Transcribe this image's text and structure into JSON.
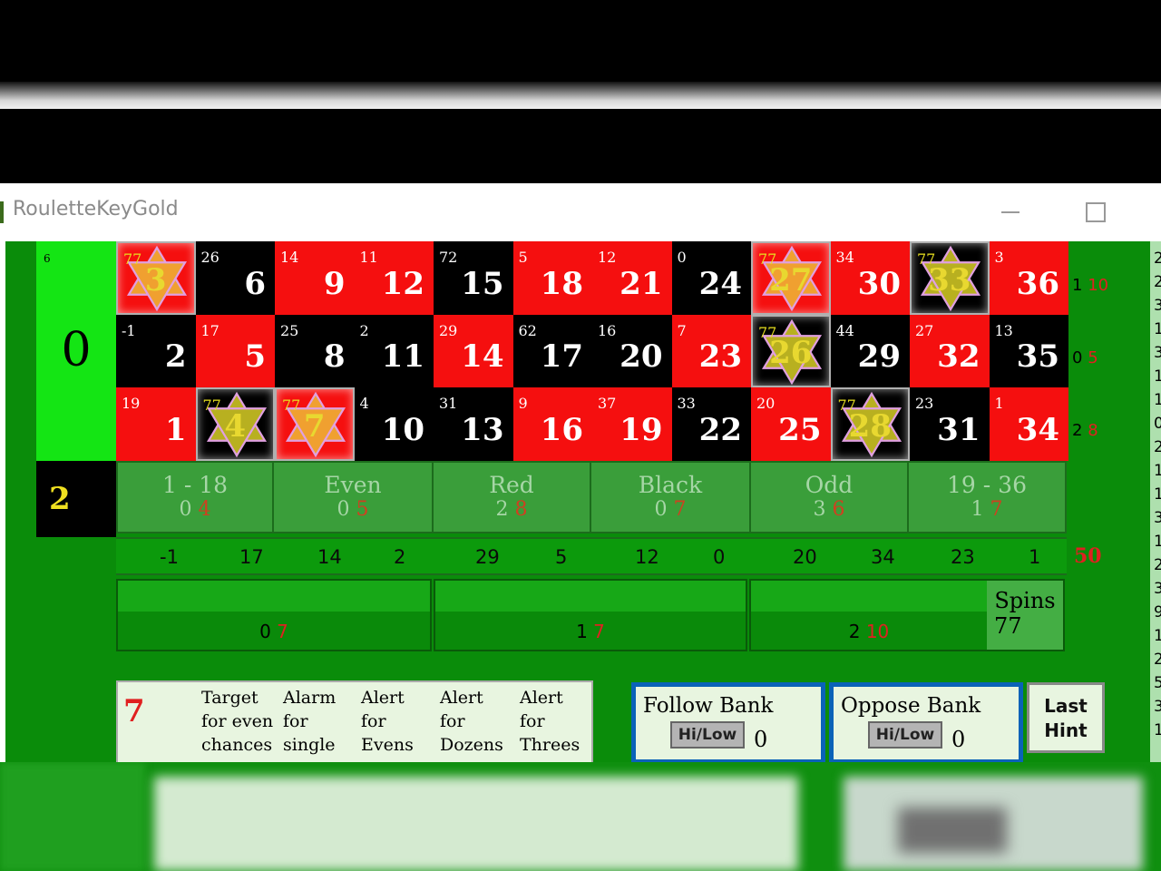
{
  "window": {
    "title": "RouletteKeyGold"
  },
  "zero": {
    "count": "6",
    "number": "0"
  },
  "cells": [
    {
      "n": "3",
      "c": "77",
      "color": "red",
      "hi": true
    },
    {
      "n": "6",
      "c": "26",
      "color": "black",
      "hi": false
    },
    {
      "n": "9",
      "c": "14",
      "color": "red",
      "hi": false
    },
    {
      "n": "12",
      "c": "11",
      "color": "red",
      "hi": false
    },
    {
      "n": "15",
      "c": "72",
      "color": "black",
      "hi": false
    },
    {
      "n": "18",
      "c": "5",
      "color": "red",
      "hi": false
    },
    {
      "n": "21",
      "c": "12",
      "color": "red",
      "hi": false
    },
    {
      "n": "24",
      "c": "0",
      "color": "black",
      "hi": false
    },
    {
      "n": "27",
      "c": "77",
      "color": "red",
      "hi": true
    },
    {
      "n": "30",
      "c": "34",
      "color": "red",
      "hi": false
    },
    {
      "n": "33",
      "c": "77",
      "color": "black",
      "hi": true
    },
    {
      "n": "36",
      "c": "3",
      "color": "red",
      "hi": false
    },
    {
      "n": "2",
      "c": "-1",
      "color": "black",
      "hi": false
    },
    {
      "n": "5",
      "c": "17",
      "color": "red",
      "hi": false
    },
    {
      "n": "8",
      "c": "25",
      "color": "black",
      "hi": false
    },
    {
      "n": "11",
      "c": "2",
      "color": "black",
      "hi": false
    },
    {
      "n": "14",
      "c": "29",
      "color": "red",
      "hi": false
    },
    {
      "n": "17",
      "c": "62",
      "color": "black",
      "hi": false
    },
    {
      "n": "20",
      "c": "16",
      "color": "black",
      "hi": false
    },
    {
      "n": "23",
      "c": "7",
      "color": "red",
      "hi": false
    },
    {
      "n": "26",
      "c": "77",
      "color": "black",
      "hi": true
    },
    {
      "n": "29",
      "c": "44",
      "color": "black",
      "hi": false
    },
    {
      "n": "32",
      "c": "27",
      "color": "red",
      "hi": false
    },
    {
      "n": "35",
      "c": "13",
      "color": "black",
      "hi": false
    },
    {
      "n": "1",
      "c": "19",
      "color": "red",
      "hi": false
    },
    {
      "n": "4",
      "c": "77",
      "color": "black",
      "hi": true
    },
    {
      "n": "7",
      "c": "77",
      "color": "red",
      "hi": true
    },
    {
      "n": "10",
      "c": "4",
      "color": "black",
      "hi": false
    },
    {
      "n": "13",
      "c": "31",
      "color": "black",
      "hi": false
    },
    {
      "n": "16",
      "c": "9",
      "color": "red",
      "hi": false
    },
    {
      "n": "19",
      "c": "37",
      "color": "red",
      "hi": false
    },
    {
      "n": "22",
      "c": "33",
      "color": "black",
      "hi": false
    },
    {
      "n": "25",
      "c": "20",
      "color": "red",
      "hi": false
    },
    {
      "n": "28",
      "c": "77",
      "color": "black",
      "hi": true
    },
    {
      "n": "31",
      "c": "23",
      "color": "black",
      "hi": false
    },
    {
      "n": "34",
      "c": "1",
      "color": "red",
      "hi": false
    }
  ],
  "row_side": [
    {
      "a": "1",
      "b": "10"
    },
    {
      "a": "0",
      "b": "5"
    },
    {
      "a": "2",
      "b": "8"
    }
  ],
  "dozen_box": "2",
  "even_bets": [
    {
      "label": "1 - 18",
      "a": "0",
      "b": "4"
    },
    {
      "label": "Even",
      "a": "0",
      "b": "5"
    },
    {
      "label": "Red",
      "a": "2",
      "b": "8"
    },
    {
      "label": "Black",
      "a": "0",
      "b": "7"
    },
    {
      "label": "Odd",
      "a": "3",
      "b": "6"
    },
    {
      "label": "19 - 36",
      "a": "1",
      "b": "7"
    }
  ],
  "history": [
    "-1",
    "17",
    "14",
    "2",
    "29",
    "5",
    "12",
    "0",
    "20",
    "34",
    "23",
    "1"
  ],
  "history_total": "50",
  "columns": [
    {
      "a": "0",
      "b": "7"
    },
    {
      "a": "1",
      "b": "7"
    },
    {
      "a": "2",
      "b": "10"
    }
  ],
  "spins": {
    "label": "Spins",
    "value": "77"
  },
  "info": {
    "big": "7",
    "cols": [
      [
        "Target",
        "for even",
        "chances"
      ],
      [
        "Alarm",
        "for",
        "single"
      ],
      [
        "Alert",
        "for",
        "Evens"
      ],
      [
        "Alert",
        "for",
        "Dozens"
      ],
      [
        "Alert",
        "for",
        "Threes"
      ]
    ]
  },
  "follow_bank": {
    "label": "Follow Bank",
    "button": "Hi/Low",
    "value": "0"
  },
  "oppose_bank": {
    "label": "Oppose Bank",
    "button": "Hi/Low",
    "value": "0"
  },
  "last_hint": [
    "Last",
    "Hint"
  ],
  "right_strip": [
    "2",
    "2",
    "3",
    "1",
    "3",
    "1",
    "1",
    "0",
    "2",
    "1",
    "1",
    "3",
    "1",
    "2",
    "3",
    "9",
    "1",
    "2",
    "5",
    "3",
    "1"
  ],
  "colors": {
    "red": "#f50f0f",
    "black": "#000000",
    "table_green": "#0a8c0a",
    "zero_green": "#14e514",
    "star": "#e8d830"
  }
}
